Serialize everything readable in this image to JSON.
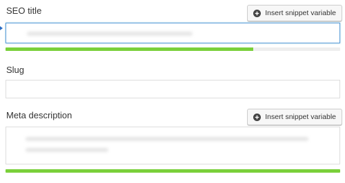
{
  "seo_title": {
    "label": "SEO title",
    "snippet_button_label": "Insert snippet variable",
    "input_value": "",
    "progress": 0.74,
    "progress_color": "#7ad03a"
  },
  "slug": {
    "label": "Slug",
    "input_value": ""
  },
  "meta_description": {
    "label": "Meta description",
    "snippet_button_label": "Insert snippet variable",
    "input_value": "",
    "progress": 1.0,
    "progress_color": "#7ad03a"
  },
  "colors": {
    "focus_border": "#5b9dd9",
    "progress_track": "#eeeeee",
    "edge_arrow": "#2b6cc4"
  },
  "icons": {
    "snippet_button_icon": "plus-circle-icon"
  }
}
